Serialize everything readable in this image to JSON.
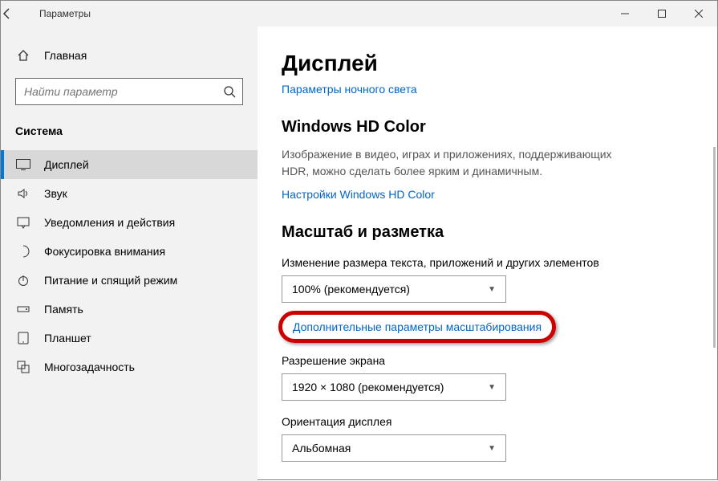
{
  "titlebar": {
    "title": "Параметры"
  },
  "sidebar": {
    "home_label": "Главная",
    "search_placeholder": "Найти параметр",
    "group_label": "Система",
    "items": [
      {
        "label": "Дисплей"
      },
      {
        "label": "Звук"
      },
      {
        "label": "Уведомления и действия"
      },
      {
        "label": "Фокусировка внимания"
      },
      {
        "label": "Питание и спящий режим"
      },
      {
        "label": "Память"
      },
      {
        "label": "Планшет"
      },
      {
        "label": "Многозадачность"
      }
    ]
  },
  "content": {
    "heading": "Дисплей",
    "night_light_link": "Параметры ночного света",
    "hd_heading": "Windows HD Color",
    "hd_desc": "Изображение в видео, играх и приложениях, поддерживающих HDR, можно сделать более ярким и динамичным.",
    "hd_link": "Настройки Windows HD Color",
    "scale_heading": "Масштаб и разметка",
    "scale_label": "Изменение размера текста, приложений и других элементов",
    "scale_value": "100% (рекомендуется)",
    "advanced_link": "Дополнительные параметры масштабирования",
    "res_label": "Разрешение экрана",
    "res_value": "1920 × 1080 (рекомендуется)",
    "orient_label": "Ориентация дисплея",
    "orient_value": "Альбомная"
  }
}
